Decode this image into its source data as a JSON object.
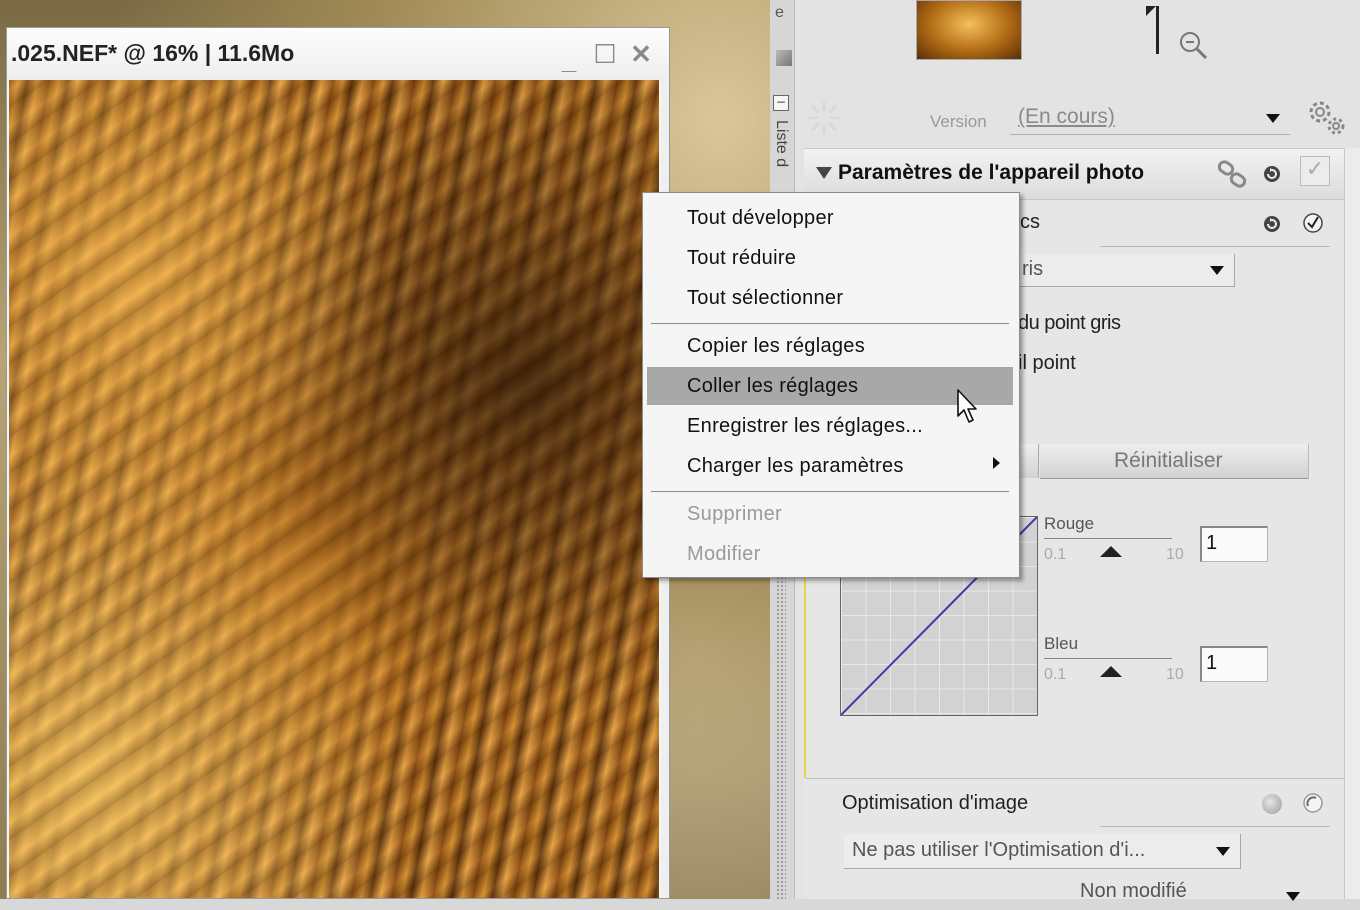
{
  "image_window": {
    "title": ".025.NEF* @ 16% | 11.6Mo",
    "minimize_label": "_",
    "maximize_label": "☐",
    "close_label": "✕"
  },
  "sidebar": {
    "top_letter": "e",
    "collapse_label": "−",
    "vertical_label": "Liste d"
  },
  "version": {
    "label": "Version",
    "value": "(En cours)"
  },
  "camera_section": {
    "title": "Paramètres de l'appareil photo",
    "check_label": "✓",
    "sub_header_partial": "cs",
    "wb_select_partial": "ris",
    "gray_point_partial": "du point gris",
    "point_partial": "il point",
    "reset_button": "Réinitialiser",
    "sliders": [
      {
        "label": "Rouge",
        "min": "0.1",
        "max": "10",
        "value": "1"
      },
      {
        "label": "Bleu",
        "min": "0.1",
        "max": "10",
        "value": "1"
      }
    ]
  },
  "optimisation": {
    "title": "Optimisation d'image",
    "select_value": "Ne pas utiliser l'Optimisation d'i...",
    "bottom_select_value": "Non modifié"
  },
  "context_menu": {
    "items": [
      {
        "label": "Tout développer",
        "disabled": false
      },
      {
        "label": "Tout réduire",
        "disabled": false
      },
      {
        "label": "Tout sélectionner",
        "disabled": false
      },
      {
        "label": "Copier les réglages",
        "disabled": false
      },
      {
        "label": "Coller les réglages",
        "disabled": false,
        "highlighted": true
      },
      {
        "label": "Enregistrer les réglages...",
        "disabled": false
      },
      {
        "label": "Charger les paramètres",
        "disabled": false,
        "submenu": true
      },
      {
        "label": "Supprimer",
        "disabled": true
      },
      {
        "label": "Modifier",
        "disabled": true
      }
    ]
  },
  "colors": {
    "menu_highlight": "#a8a8a8",
    "curve_line": "#4a32a8",
    "accent_yellow": "#e8d44a"
  },
  "icons": {
    "zoom": "zoom-out-icon",
    "gear": "gear-icon",
    "link": "link-icon",
    "reset": "reset-icon",
    "throbber": "throbber-icon",
    "cursor": "mouse-pointer-icon"
  }
}
